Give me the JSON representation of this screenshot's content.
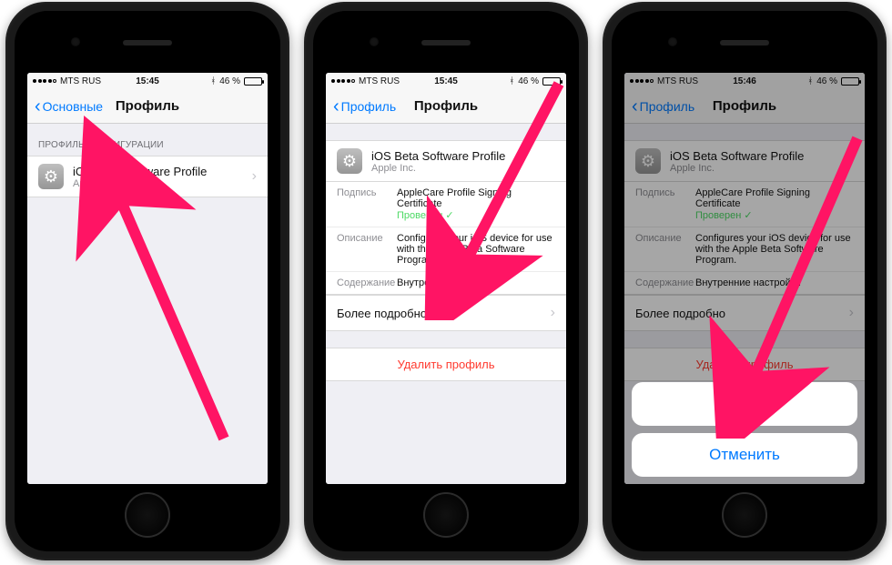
{
  "colors": {
    "accent": "#007aff",
    "danger": "#ff3b30",
    "verified": "#4cd964",
    "arrow": "#ff1464"
  },
  "phones": [
    {
      "statusbar": {
        "carrier": "MTS RUS",
        "time": "15:45",
        "bt": "✱",
        "battery_pct": "46 %"
      },
      "nav": {
        "back": "Основные",
        "title": "Профиль"
      },
      "section_header": "ПРОФИЛЬ КОНФИГУРАЦИИ",
      "profile": {
        "title": "iOS Beta Software Profile",
        "sub": "Apple Inc."
      }
    },
    {
      "statusbar": {
        "carrier": "MTS RUS",
        "time": "15:45",
        "bt": "✱",
        "battery_pct": "46 %"
      },
      "nav": {
        "back": "Профиль",
        "title": "Профиль"
      },
      "profile": {
        "title": "iOS Beta Software Profile",
        "sub": "Apple Inc."
      },
      "rows": {
        "sign_k": "Подпись",
        "sign_v": "AppleCare Profile Signing Certificate",
        "verified": "Проверен",
        "desc_k": "Описание",
        "desc_v": "Configures your iOS device for use with the Apple Beta Software Program.",
        "cont_k": "Содержание",
        "cont_v": "Внутренние настройки"
      },
      "more": "Более подробно",
      "delete": "Удалить профиль"
    },
    {
      "statusbar": {
        "carrier": "MTS RUS",
        "time": "15:46",
        "bt": "✱",
        "battery_pct": "46 %"
      },
      "nav": {
        "back": "Профиль",
        "title": "Профиль"
      },
      "profile": {
        "title": "iOS Beta Software Profile",
        "sub": "Apple Inc."
      },
      "rows": {
        "sign_k": "Подпись",
        "sign_v": "AppleCare Profile Signing Certificate",
        "verified": "Проверен",
        "desc_k": "Описание",
        "desc_v": "Configures your iOS device for use with the Apple Beta Software Program.",
        "cont_k": "Содержание",
        "cont_v": "Внутренние настройки"
      },
      "more": "Более подробно",
      "delete": "Удалить профиль",
      "sheet": {
        "delete": "Удалить",
        "cancel": "Отменить"
      }
    }
  ]
}
